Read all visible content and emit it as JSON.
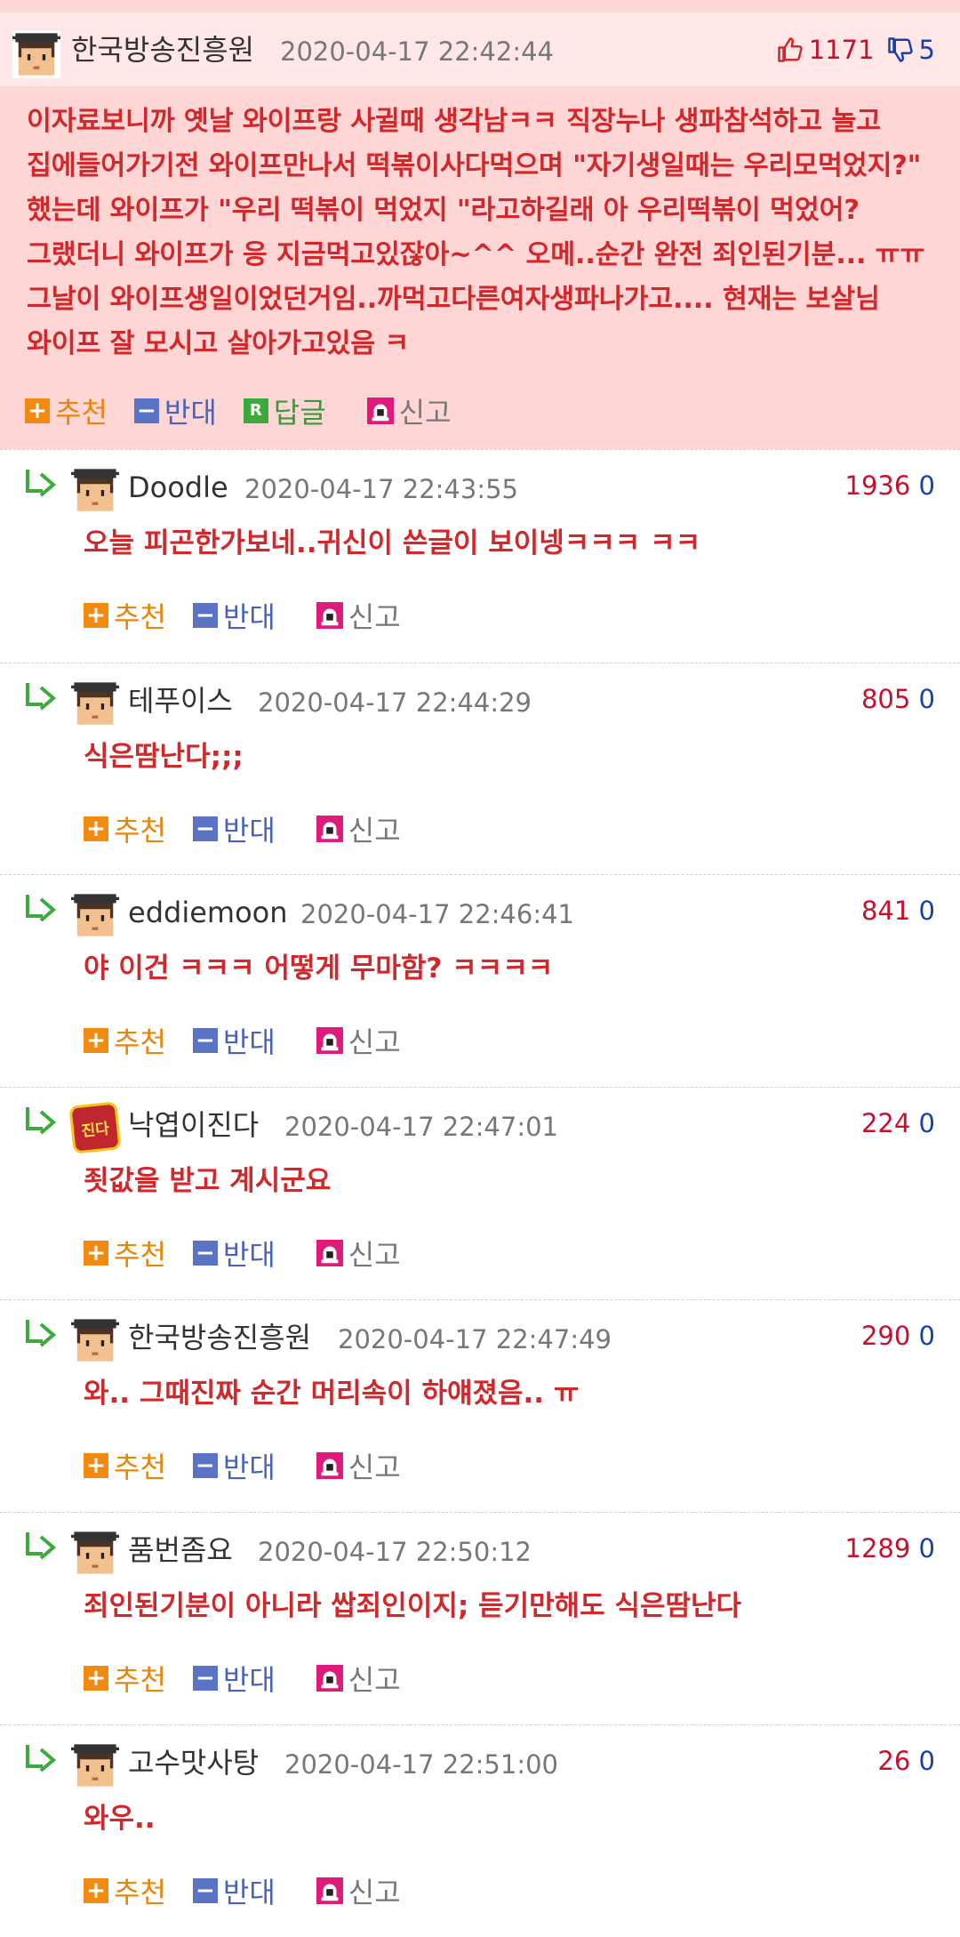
{
  "main_comment": {
    "nickname": "한국방송진흥원",
    "date": "2020-04-17 22:42:44",
    "upvotes": "1171",
    "downvotes": "5",
    "body": "이자료보니까 옛날 와이프랑 사귈때 생각남ㅋㅋ 직장누나 생파참석하고 놀고 집에들어가기전 와이프만나서 떡볶이사다먹으며 \"자기생일때는 우리모먹었지?\" 했는데 와이프가 \"우리 떡볶이 먹었지 \"라고하길래 아 우리떡볶이 먹었어? 그랬더니 와이프가 응 지금먹고있잖아~^^ 오메..순간 완전 죄인된기분... ㅠㅠ 그날이 와이프생일이었던거임..까먹고다른여자생파나가고.... 현재는 보살님 와이프 잘 모시고 살아가고있음 ㅋ",
    "avatar_icon": "default-avatar-icon"
  },
  "actions": {
    "recommend": "추천",
    "oppose": "반대",
    "reply": "답글",
    "report": "신고",
    "reply_badge": "R"
  },
  "replies": [
    {
      "nickname": "Doodle",
      "date": "2020-04-17 22:43:55",
      "upvotes": "1936",
      "downvotes": "0",
      "body": "오늘 피곤한가보네..귀신이 쓴글이 보이넹ㅋㅋㅋ ㅋㅋ",
      "avatar_icon": "default-avatar-icon"
    },
    {
      "nickname": "테푸이스",
      "date": "2020-04-17 22:44:29",
      "upvotes": "805",
      "downvotes": "0",
      "body": "식은땀난다;;;",
      "avatar_icon": "default-avatar-icon"
    },
    {
      "nickname": "eddiemoon",
      "date": "2020-04-17 22:46:41",
      "upvotes": "841",
      "downvotes": "0",
      "body": "야 이건 ㅋㅋㅋ 어떻게 무마함? ㅋㅋㅋㅋ",
      "avatar_icon": "default-avatar-icon"
    },
    {
      "nickname": "낙엽이진다",
      "date": "2020-04-17 22:47:01",
      "upvotes": "224",
      "downvotes": "0",
      "body": "죗값을 받고 계시군요",
      "avatar_icon": "jinda-badge-icon",
      "avatar_text": "진다"
    },
    {
      "nickname": "한국방송진흥원",
      "date": "2020-04-17 22:47:49",
      "upvotes": "290",
      "downvotes": "0",
      "body": "와.. 그때진짜 순간 머리속이 하얘졌음.. ㅠ",
      "avatar_icon": "default-avatar-icon"
    },
    {
      "nickname": "품번좀요",
      "date": "2020-04-17 22:50:12",
      "upvotes": "1289",
      "downvotes": "0",
      "body": "죄인된기분이 아니라 쌉죄인이지; 듣기만해도 식은땀난다",
      "avatar_icon": "default-avatar-icon"
    },
    {
      "nickname": "고수맛사탕",
      "date": "2020-04-17 22:51:00",
      "upvotes": "26",
      "downvotes": "0",
      "body": "와우..",
      "avatar_icon": "default-avatar-icon"
    }
  ],
  "colors": {
    "best_bg": "#ffd6d6",
    "best_head_bg": "#ffe7e7",
    "comment_text": "#d0282b",
    "upvote": "#c8102e",
    "downvote": "#1a3fa6",
    "recommend": "#f28a12",
    "oppose": "#5a73c4",
    "reply": "#3caa3c",
    "report": "#e01a7a"
  }
}
